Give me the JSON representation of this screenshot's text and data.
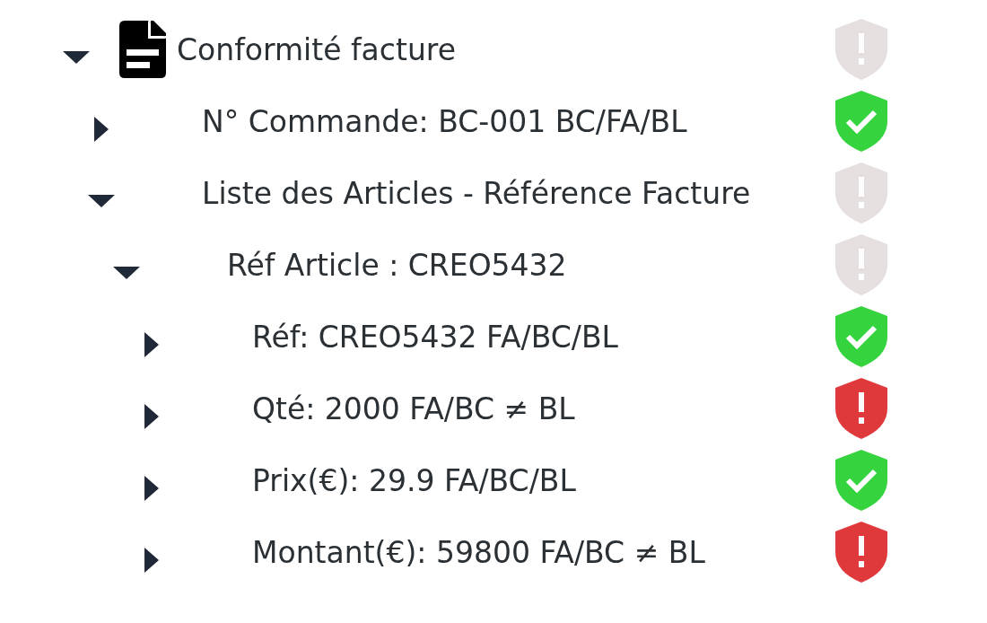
{
  "tree": {
    "label": "Conformité facture",
    "expanded": true,
    "kind": "pending",
    "children": [
      {
        "label": "N° Commande: BC-001 BC/FA/BL",
        "expanded": false,
        "kind": "ok"
      },
      {
        "label": "Liste des Articles - Référence Facture",
        "expanded": true,
        "kind": "pending",
        "children": [
          {
            "label": "Réf Article : CREO5432",
            "expanded": true,
            "kind": "pending",
            "children": [
              {
                "label": "Réf: CREO5432 FA/BC/BL",
                "expanded": false,
                "kind": "ok"
              },
              {
                "label": "Qté: 2000 FA/BC ≠ BL",
                "expanded": false,
                "kind": "error"
              },
              {
                "label": "Prix(€): 29.9 FA/BC/BL",
                "expanded": false,
                "kind": "ok"
              },
              {
                "label": "Montant(€): 59800 FA/BC ≠ BL",
                "expanded": false,
                "kind": "error"
              }
            ]
          }
        ]
      }
    ]
  }
}
